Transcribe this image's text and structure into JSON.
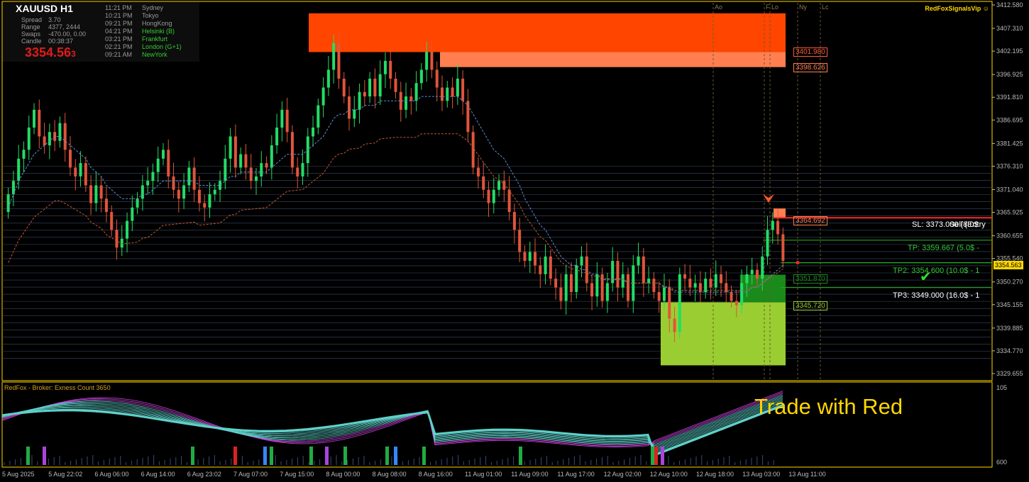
{
  "header": {
    "symbol": "XAUUSD",
    "timeframe": "H1",
    "symbol_line": "XAUUSD   H1"
  },
  "info": {
    "spread_label": "Spread",
    "spread": "3.70",
    "range_label": "Range",
    "range": "4377, 2444",
    "swaps_label": "Swaps",
    "swaps": "-470.00, 0.00",
    "candle_label": "Candle",
    "candle": "00:38:37",
    "price_big": "3354.56",
    "price_small": "3"
  },
  "sessions": [
    {
      "time": "11:21 PM",
      "name": "Sydney",
      "color": "#9a9a9a"
    },
    {
      "time": "10:21 PM",
      "name": "Tokyo",
      "color": "#9a9a9a"
    },
    {
      "time": "09:21 PM",
      "name": "HongKong",
      "color": "#9a9a9a"
    },
    {
      "time": "04:21 PM",
      "name": "Helsinki  (B)",
      "color": "#33cc33"
    },
    {
      "time": "03:21 PM",
      "name": "Frankfurt",
      "color": "#33cc33"
    },
    {
      "time": "02:21 PM",
      "name": "London  (G+1)",
      "color": "#33cc33"
    },
    {
      "time": "09:21 AM",
      "name": "NewYork",
      "color": "#33cc33"
    }
  ],
  "brand": "RedFoxSignalsVip",
  "session_markers": [
    "Ao",
    "F",
    "Lo",
    "Ny",
    "Lc"
  ],
  "trade": {
    "sl": "SL: 3373.000 (8.0$",
    "entry": "Sell (Entry",
    "tp1": "TP: 3359.667 (5.0$ -",
    "tp2": "TP2: 3354.600 (10.0$ - 1",
    "tp3": "TP3: 3349.000 (16.0$ - 1"
  },
  "zone_labels": {
    "z1": "3401.980",
    "z2": "3398.626",
    "z3": "3364.692",
    "z4": "3351.870",
    "z5": "3345.720"
  },
  "current_price": "3354.563",
  "indicator": {
    "label": "RedFox - Broker: Exness   Count  3650",
    "top": "105",
    "bottom": "600",
    "overlay_text": "Trade with Red"
  },
  "colors": {
    "bull": "#22dd66",
    "bear": "#e0553a",
    "zone_red": "#ff4500",
    "zone_salmon": "#ff7f50",
    "zone_green": "#9acd32",
    "zone_dkgreen": "#1a8a1a",
    "axis": "#ffd700"
  },
  "chart_data": {
    "type": "candlestick",
    "symbol": "XAUUSD",
    "timeframe": "H1",
    "ylim": [
      3329.655,
      3412.58
    ],
    "y_ticks": [
      3412.58,
      3407.31,
      3402.195,
      3396.925,
      3391.81,
      3386.695,
      3381.425,
      3376.31,
      3371.04,
      3365.925,
      3360.655,
      3355.54,
      3350.27,
      3345.155,
      3339.885,
      3334.77,
      3329.655
    ],
    "x_ticks": [
      "5 Aug 2025",
      "5 Aug 22:02",
      "6 Aug 06:00",
      "6 Aug 14:00",
      "6 Aug 23:02",
      "7 Aug 07:00",
      "7 Aug 15:00",
      "8 Aug 00:00",
      "8 Aug 08:00",
      "8 Aug 16:00",
      "11 Aug 01:00",
      "11 Aug 09:00",
      "11 Aug 17:00",
      "12 Aug 02:00",
      "12 Aug 10:00",
      "12 Aug 18:00",
      "13 Aug 03:00",
      "13 Aug 11:00"
    ],
    "ohlc_close": [
      3370,
      3373,
      3378,
      3380,
      3385,
      3389,
      3383,
      3381,
      3384,
      3382,
      3386,
      3380,
      3376,
      3374,
      3377,
      3372,
      3368,
      3372,
      3369,
      3366,
      3362,
      3358,
      3360,
      3364,
      3367,
      3369,
      3372,
      3373,
      3375,
      3378,
      3380,
      3374,
      3371,
      3369,
      3372,
      3376,
      3371,
      3368,
      3367,
      3370,
      3371,
      3373,
      3378,
      3383,
      3376,
      3379,
      3376,
      3373,
      3374,
      3377,
      3376,
      3381,
      3385,
      3389,
      3384,
      3376,
      3374,
      3377,
      3383,
      3385,
      3390,
      3394,
      3398,
      3404,
      3396,
      3392,
      3387,
      3389,
      3393,
      3392,
      3396,
      3392,
      3397,
      3400,
      3396,
      3393,
      3389,
      3392,
      3391,
      3395,
      3398,
      3402,
      3398,
      3394,
      3391,
      3394,
      3392,
      3396,
      3391,
      3384,
      3376,
      3374,
      3371,
      3368,
      3371,
      3373,
      3371,
      3366,
      3362,
      3357,
      3355,
      3357,
      3354,
      3352,
      3356,
      3351,
      3349,
      3346,
      3352,
      3348,
      3354,
      3356,
      3350,
      3347,
      3352,
      3346,
      3350,
      3355,
      3349,
      3352,
      3346,
      3354,
      3356,
      3350,
      3351,
      3348,
      3346,
      3349,
      3342,
      3339,
      3352,
      3351,
      3349,
      3350,
      3348,
      3351,
      3349,
      3352,
      3350,
      3348,
      3346,
      3345,
      3350,
      3352,
      3353,
      3351,
      3356,
      3362,
      3364,
      3361,
      3355
    ],
    "ema_fast": [
      3367,
      3370,
      3373,
      3375,
      3377,
      3379,
      3380,
      3381,
      3382,
      3383,
      3383,
      3382,
      3381,
      3380,
      3379,
      3378,
      3376,
      3375,
      3374,
      3372,
      3371,
      3370,
      3369,
      3369,
      3369,
      3369,
      3370,
      3370,
      3371,
      3372,
      3373,
      3373,
      3373,
      3373,
      3373,
      3373,
      3373,
      3372,
      3372,
      3372,
      3372,
      3372,
      3373,
      3374,
      3374,
      3375,
      3375,
      3375,
      3375,
      3375,
      3375,
      3376,
      3377,
      3378,
      3379,
      3379,
      3379,
      3379,
      3380,
      3381,
      3382,
      3383,
      3385,
      3387,
      3388,
      3388,
      3389,
      3389,
      3389,
      3390,
      3390,
      3390,
      3391,
      3391,
      3391,
      3391,
      3391,
      3391,
      3391,
      3391,
      3392,
      3392,
      3392,
      3392,
      3392,
      3392,
      3392,
      3392,
      3391,
      3390,
      3388,
      3386,
      3384,
      3382,
      3380,
      3379,
      3378,
      3376,
      3374,
      3372,
      3369,
      3367,
      3365,
      3363,
      3362,
      3360,
      3358,
      3356,
      3355,
      3354,
      3354,
      3353,
      3353,
      3352,
      3352,
      3351,
      3351,
      3351,
      3351,
      3351,
      3350,
      3350,
      3350,
      3350,
      3350,
      3350,
      3350,
      3349,
      3349,
      3348,
      3348,
      3348,
      3348,
      3348,
      3348,
      3348,
      3348,
      3348,
      3348,
      3348,
      3348,
      3348,
      3348,
      3348,
      3349,
      3349,
      3350,
      3351,
      3352,
      3353,
      3354
    ]
  }
}
